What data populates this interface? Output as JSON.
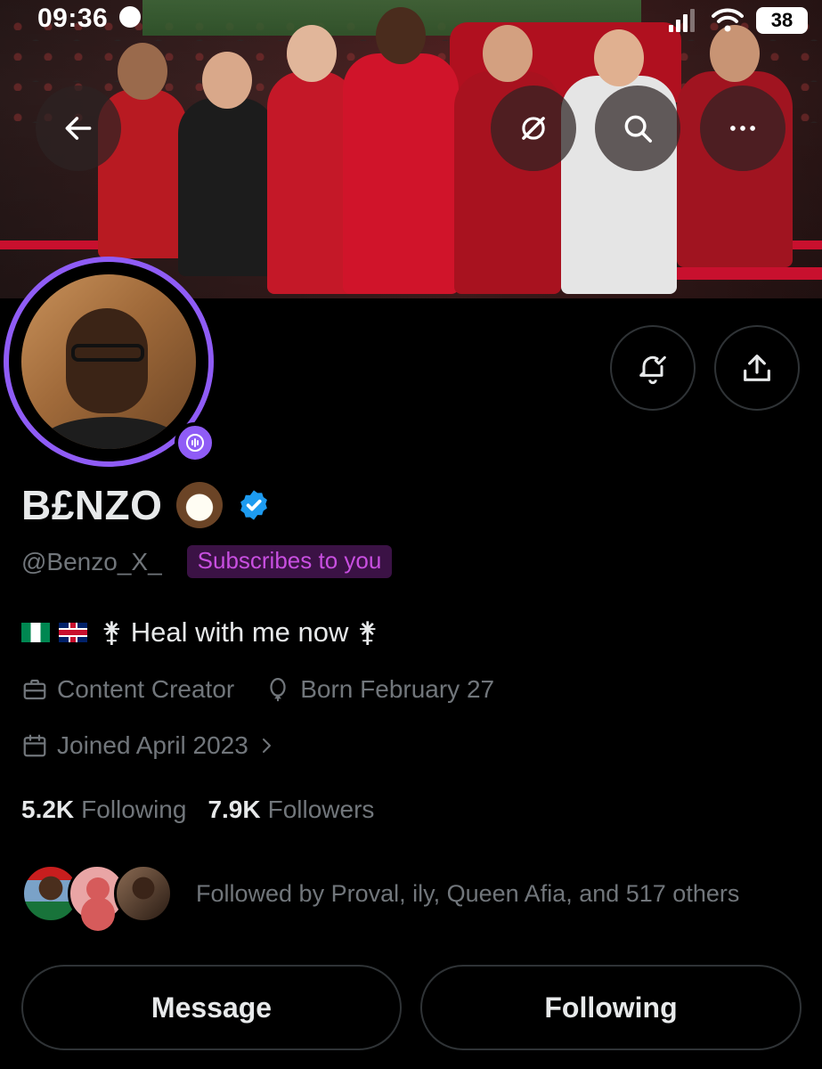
{
  "status_bar": {
    "time": "09:36",
    "battery": "38"
  },
  "banner": {
    "back_icon": "arrow-left-icon",
    "grok_icon": "grok-icon",
    "search_icon": "search-icon",
    "more_icon": "more-horizontal-icon"
  },
  "profile": {
    "name": "B£NZO",
    "name_emoji": "coconut-icon",
    "verified_icon": "verified-badge-icon",
    "handle": "@Benzo_X_",
    "subscribes_badge": "Subscribes to you",
    "bio_text": "Heal with me now",
    "bio_flags": [
      "nigeria-flag",
      "uk-flag"
    ],
    "bio_symbol": "⚵",
    "category": "Content Creator",
    "birthday": "Born February 27",
    "joined": "Joined April 2023",
    "following_count": "5.2K",
    "following_label": "Following",
    "followers_count": "7.9K",
    "followers_label": "Followers",
    "followed_by": "Followed by Proval, ily, Queen Afia, and 517 others"
  },
  "actions": {
    "notify_icon": "bell-check-icon",
    "share_icon": "share-icon",
    "message_label": "Message",
    "following_label": "Following"
  },
  "colors": {
    "accent_purple": "#8f5cf6",
    "verified_blue": "#1d9bf0",
    "subscribe_bg": "#3b1245",
    "subscribe_fg": "#c84fe0",
    "muted": "#71767b",
    "text": "#e7e9ea",
    "border": "#2f3336"
  }
}
